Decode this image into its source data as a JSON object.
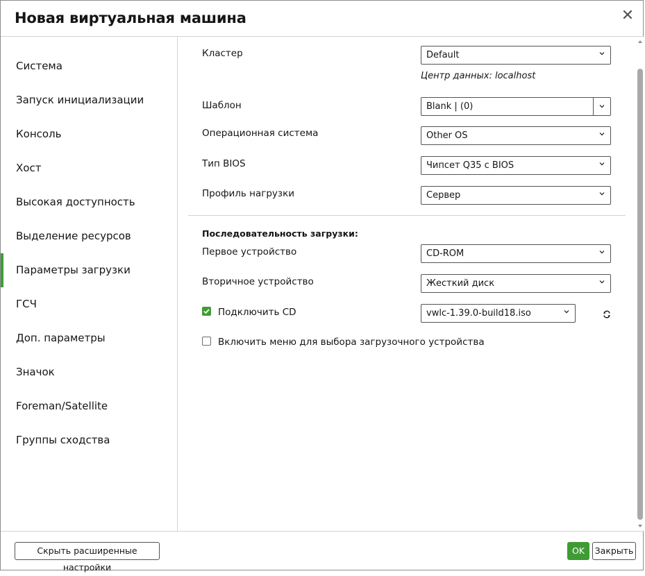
{
  "dialog": {
    "title": "Новая виртуальная машина",
    "close_glyph": "✕"
  },
  "sidebar": {
    "items": [
      {
        "label": "Система",
        "active": false
      },
      {
        "label": "Запуск инициализации",
        "active": false
      },
      {
        "label": "Консоль",
        "active": false
      },
      {
        "label": "Хост",
        "active": false
      },
      {
        "label": "Высокая доступность",
        "active": false
      },
      {
        "label": "Выделение ресурсов",
        "active": false
      },
      {
        "label": "Параметры загрузки",
        "active": true
      },
      {
        "label": "ГСЧ",
        "active": false
      },
      {
        "label": "Доп. параметры",
        "active": false
      },
      {
        "label": "Значок",
        "active": false
      },
      {
        "label": "Foreman/Satellite",
        "active": false
      },
      {
        "label": "Группы сходства",
        "active": false
      }
    ]
  },
  "form": {
    "cluster": {
      "label": "Кластер",
      "value": "Default",
      "note": "Центр данных: localhost"
    },
    "template": {
      "label": "Шаблон",
      "value": "Blank |  (0)"
    },
    "os": {
      "label": "Операционная система",
      "value": "Other OS"
    },
    "bios": {
      "label": "Тип BIOS",
      "value": "Чипсет Q35 с BIOS"
    },
    "profile": {
      "label": "Профиль нагрузки",
      "value": "Сервер"
    },
    "boot_sequence_title": "Последовательность загрузки:",
    "first_device": {
      "label": "Первое устройство",
      "value": "CD-ROM"
    },
    "second_device": {
      "label": "Вторичное устройство",
      "value": "Жесткий диск"
    },
    "attach_cd": {
      "label": "Подключить CD",
      "checked": true,
      "value": "vwlc-1.39.0-build18.iso"
    },
    "boot_menu": {
      "label": "Включить меню для выбора загрузочного устройства",
      "checked": false
    }
  },
  "footer": {
    "hide_advanced_label": "Скрыть расширенные настройки",
    "ok_label": "OK",
    "close_label": "Закрыть"
  },
  "colors": {
    "accent": "#3f9c35",
    "border": "#4f5255",
    "divider": "#d2d2d2"
  },
  "icons": {
    "close": "close-icon",
    "dropdown": "chevron-down-icon",
    "refresh": "refresh-icon",
    "check": "checkmark-icon"
  }
}
